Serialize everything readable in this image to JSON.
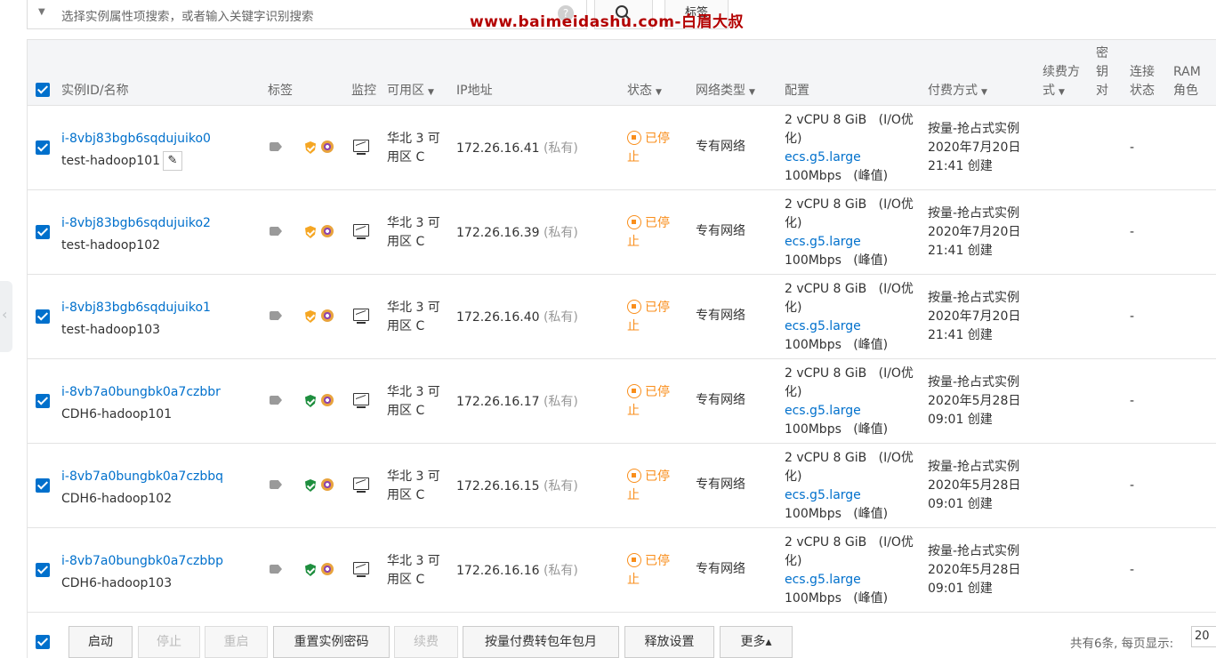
{
  "search": {
    "placeholder": "选择实例属性项搜索，或者输入关键字识别搜索",
    "help_glyph": "?",
    "search_icon": "search-icon",
    "tag_button": "标签"
  },
  "watermark": "www.baimeidashu.com-白眉大叔",
  "columns": {
    "instance": "实例ID/名称",
    "tags": "标签",
    "monitor": "监控",
    "zone": "可用区",
    "ip": "IP地址",
    "status": "状态",
    "network": "网络类型",
    "config": "配置",
    "billing": "付费方式",
    "renew_1": "续费方",
    "renew_2": "式",
    "key_1": "密",
    "key_2": "钥",
    "key_3": "对",
    "conn_1": "连接",
    "conn_2": "状态",
    "ram_1": "RAM",
    "ram_2": "角色"
  },
  "rows": [
    {
      "id": "i-8vbj83bgb6sqdujuiko0",
      "name": "test-hadoop101",
      "zone_1": "华北 3 可",
      "zone_2": "用区 C",
      "ip": "172.26.16.41",
      "ip_type": "(私有)",
      "status_1": "已停",
      "status_2": "止",
      "network": "专有网络",
      "cfg_1": "2 vCPU 8 GiB   (I/O优",
      "cfg_2": "化)",
      "cfg_type": "ecs.g5.large",
      "cfg_bw": "100Mbps   (峰值)",
      "bill_1": "按量-抢占式实例",
      "bill_2": "2020年7月20日",
      "bill_3": "21:41 创建",
      "conn": "-",
      "shield": "orange",
      "editable": true
    },
    {
      "id": "i-8vbj83bgb6sqdujuiko2",
      "name": "test-hadoop102",
      "zone_1": "华北 3 可",
      "zone_2": "用区 C",
      "ip": "172.26.16.39",
      "ip_type": "(私有)",
      "status_1": "已停",
      "status_2": "止",
      "network": "专有网络",
      "cfg_1": "2 vCPU 8 GiB   (I/O优",
      "cfg_2": "化)",
      "cfg_type": "ecs.g5.large",
      "cfg_bw": "100Mbps   (峰值)",
      "bill_1": "按量-抢占式实例",
      "bill_2": "2020年7月20日",
      "bill_3": "21:41 创建",
      "conn": "-",
      "shield": "orange",
      "editable": false
    },
    {
      "id": "i-8vbj83bgb6sqdujuiko1",
      "name": "test-hadoop103",
      "zone_1": "华北 3 可",
      "zone_2": "用区 C",
      "ip": "172.26.16.40",
      "ip_type": "(私有)",
      "status_1": "已停",
      "status_2": "止",
      "network": "专有网络",
      "cfg_1": "2 vCPU 8 GiB   (I/O优",
      "cfg_2": "化)",
      "cfg_type": "ecs.g5.large",
      "cfg_bw": "100Mbps   (峰值)",
      "bill_1": "按量-抢占式实例",
      "bill_2": "2020年7月20日",
      "bill_3": "21:41 创建",
      "conn": "-",
      "shield": "orange",
      "editable": false
    },
    {
      "id": "i-8vb7a0bungbk0a7czbbr",
      "name": "CDH6-hadoop101",
      "zone_1": "华北 3 可",
      "zone_2": "用区 C",
      "ip": "172.26.16.17",
      "ip_type": "(私有)",
      "status_1": "已停",
      "status_2": "止",
      "network": "专有网络",
      "cfg_1": "2 vCPU 8 GiB   (I/O优",
      "cfg_2": "化)",
      "cfg_type": "ecs.g5.large",
      "cfg_bw": "100Mbps   (峰值)",
      "bill_1": "按量-抢占式实例",
      "bill_2": "2020年5月28日",
      "bill_3": "09:01 创建",
      "conn": "-",
      "shield": "green",
      "editable": false
    },
    {
      "id": "i-8vb7a0bungbk0a7czbbq",
      "name": "CDH6-hadoop102",
      "zone_1": "华北 3 可",
      "zone_2": "用区 C",
      "ip": "172.26.16.15",
      "ip_type": "(私有)",
      "status_1": "已停",
      "status_2": "止",
      "network": "专有网络",
      "cfg_1": "2 vCPU 8 GiB   (I/O优",
      "cfg_2": "化)",
      "cfg_type": "ecs.g5.large",
      "cfg_bw": "100Mbps   (峰值)",
      "bill_1": "按量-抢占式实例",
      "bill_2": "2020年5月28日",
      "bill_3": "09:01 创建",
      "conn": "-",
      "shield": "green",
      "editable": false
    },
    {
      "id": "i-8vb7a0bungbk0a7czbbp",
      "name": "CDH6-hadoop103",
      "zone_1": "华北 3 可",
      "zone_2": "用区 C",
      "ip": "172.26.16.16",
      "ip_type": "(私有)",
      "status_1": "已停",
      "status_2": "止",
      "network": "专有网络",
      "cfg_1": "2 vCPU 8 GiB   (I/O优",
      "cfg_2": "化)",
      "cfg_type": "ecs.g5.large",
      "cfg_bw": "100Mbps   (峰值)",
      "bill_1": "按量-抢占式实例",
      "bill_2": "2020年5月28日",
      "bill_3": "09:01 创建",
      "conn": "-",
      "shield": "green",
      "editable": false
    }
  ],
  "footer": {
    "buttons": [
      "启动",
      "停止",
      "重启",
      "重置实例密码",
      "续费",
      "按量付费转包年包月",
      "释放设置",
      "更多▴"
    ],
    "disabled": [
      false,
      true,
      true,
      false,
      true,
      false,
      false,
      false
    ],
    "summary": "共有6条, 每页显示:",
    "page_size": "20"
  },
  "colors": {
    "link": "#0070cc",
    "status": "#f98e1b",
    "checkbox": "#0070cc"
  }
}
